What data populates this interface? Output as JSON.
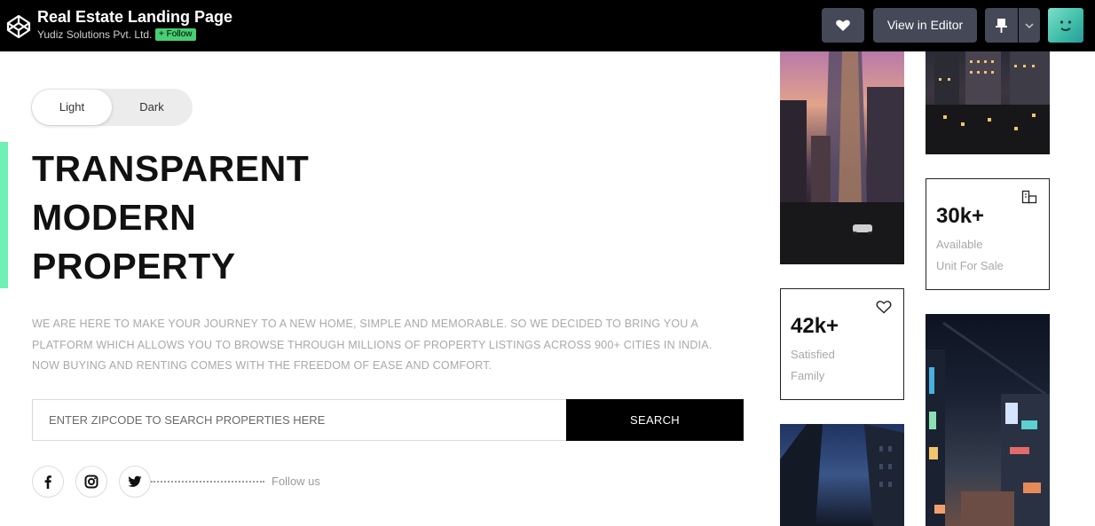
{
  "header": {
    "title": "Real Estate Landing Page",
    "owner": "Yudiz Solutions Pvt. Ltd.",
    "follow_label": "+ Follow",
    "view_in_editor": "View in Editor"
  },
  "theme_toggle": {
    "light": "Light",
    "dark": "Dark",
    "selected": "Light"
  },
  "hero": {
    "line1": "TRANSPARENT",
    "line2": "MODERN",
    "line3": "PROPERTY",
    "description": "WE ARE HERE TO MAKE YOUR JOURNEY TO A NEW HOME, SIMPLE AND MEMORABLE. SO WE DECIDED TO BRING YOU A PLATFORM WHICH ALLOWS YOU TO BROWSE THROUGH MILLIONS OF PROPERTY LISTINGS ACROSS 900+ CITIES IN INDIA. NOW BUYING AND RENTING COMES WITH THE FREEDOM OF EASE AND COMFORT."
  },
  "search": {
    "placeholder": "ENTER ZIPCODE TO SEARCH PROPERTIES HERE",
    "button": "SEARCH"
  },
  "social": {
    "icons": [
      "facebook-icon",
      "instagram-icon",
      "twitter-icon"
    ],
    "follow_text": "Follow us"
  },
  "stats": [
    {
      "value": "30k+",
      "line1": "Available",
      "line2": "Unit For Sale",
      "icon": "building-icon"
    },
    {
      "value": "42k+",
      "line1": "Satisfied",
      "line2": "Family",
      "icon": "heart-icon"
    }
  ],
  "colors": {
    "accent": "#6ff0b4",
    "topbar": "#000000",
    "button": "#444857",
    "follow_badge": "#47cf73"
  }
}
